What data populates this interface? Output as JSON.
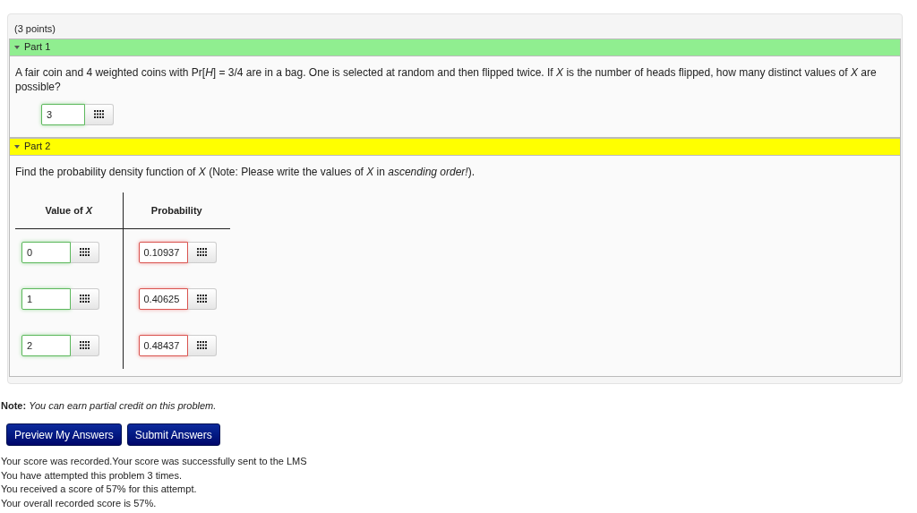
{
  "points": "(3 points)",
  "parts": [
    {
      "title": "Part 1",
      "expanded": true,
      "color": "#90ee90",
      "kind": "single",
      "prompt": "A fair coin and 4 weighted coins with Pr[*H*] = 3/4 are in a bag. One is selected at random and then flipped twice. If *X* is the number of heads flipped, how many distinct values of *X* are possible?",
      "answer": {
        "value": "3",
        "correct": true
      }
    },
    {
      "title": "Part 2",
      "expanded": true,
      "color": "#ffff00",
      "kind": "table",
      "prompt": "Find the probability density function of *X* (Note: Please write the values of *X* in *ascending order!*).",
      "columns": [
        "Value of *X*",
        "Probability"
      ],
      "rows": [
        [
          {
            "value": "0",
            "correct": true
          },
          {
            "value": "0.10937",
            "correct": false
          }
        ],
        [
          {
            "value": "1",
            "correct": true
          },
          {
            "value": "0.40625",
            "correct": false
          }
        ],
        [
          {
            "value": "2",
            "correct": true
          },
          {
            "value": "0.48437",
            "correct": false
          }
        ]
      ]
    }
  ],
  "note": "**Note:** *You can earn partial credit on this problem.*",
  "buttons": [
    "Preview My Answers",
    "Submit Answers"
  ],
  "messages": [
    "Your score was recorded.Your score was successfully sent to the LMS",
    "You have attempted this problem 3 times.",
    "You received a score of 57% for this attempt.",
    "Your overall recorded score is 57%."
  ]
}
